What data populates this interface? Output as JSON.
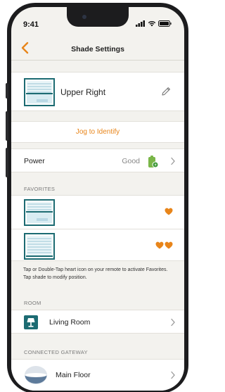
{
  "status_bar": {
    "time": "9:41"
  },
  "header": {
    "title": "Shade Settings",
    "back_icon": "chevron-left-icon"
  },
  "shade": {
    "name": "Upper Right",
    "edit_icon": "pencil-icon"
  },
  "jog": {
    "label": "Jog to Identify"
  },
  "power": {
    "label": "Power",
    "value": "Good",
    "icon": "battery-charging-icon"
  },
  "favorites": {
    "header": "FAVORITES",
    "items": [
      {
        "hearts": 1
      },
      {
        "hearts": 2
      }
    ],
    "help": "Tap or Double-Tap heart icon on your remote to activate Favorites. Tap shade to modify position."
  },
  "room": {
    "header": "ROOM",
    "name": "Living Room",
    "icon": "lamp-icon"
  },
  "gateway": {
    "header": "CONNECTED GATEWAY",
    "name": "Main Floor",
    "icon": "gateway-icon"
  },
  "colors": {
    "accent": "#e8851a",
    "battery": "#7ab648",
    "teal": "#1c6b72"
  }
}
